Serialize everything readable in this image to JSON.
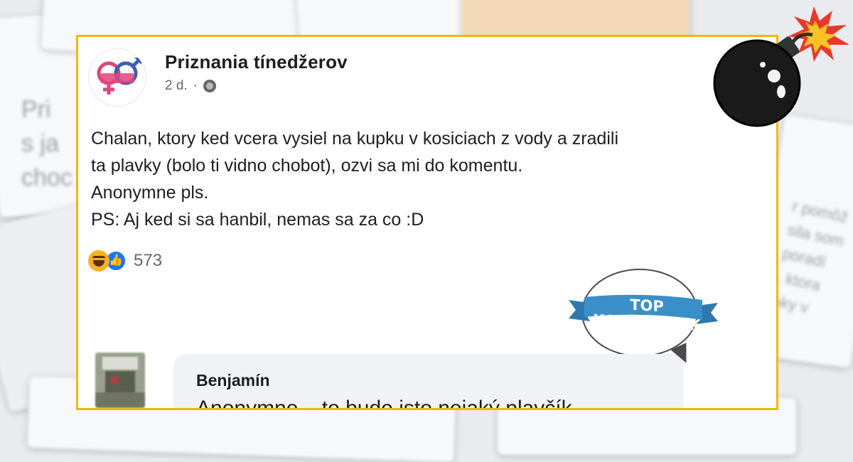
{
  "post": {
    "page_name": "Priznania tínedžerov",
    "time": "2 d.",
    "separator": "·",
    "body_lines": [
      "Chalan, ktory ked vcera vysiel na kupku v kosiciach z vody a zradili",
      "ta plavky (bolo ti vidno chobot), ozvi sa mi do komentu.",
      "Anonymne pls.",
      "PS: Aj ked si sa hanbil, nemas sa za co :D"
    ],
    "reaction_count": "573",
    "reaction_icons": [
      "haha-icon",
      "like-icon"
    ]
  },
  "logo": {
    "text": "TOP KOMENTY.SK",
    "ribbon_color": "#3b8fc9"
  },
  "comment": {
    "author": "Benjamín",
    "text": "Anonymne... to bude isto nejaký plavčík"
  },
  "colors": {
    "frame": "#f2b705",
    "text": "#1c1e21",
    "muted": "#65676b",
    "brand_pink": "#e0457b",
    "brand_blue": "#3b5fb6"
  }
}
